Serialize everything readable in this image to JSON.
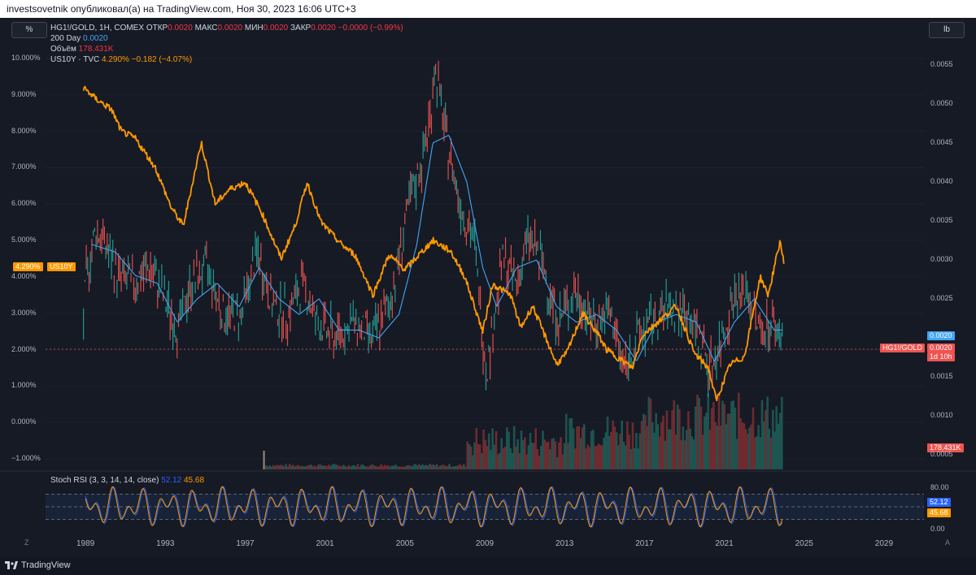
{
  "header": {
    "text": "investsovetnik опубликовал(а) на TradingView.com, Ноя 30, 2023 16:06 UTC+3"
  },
  "legend": {
    "symbol": "HG1!/GOLD, 1H, COMEX",
    "open_label": "ОТКР",
    "open": "0.0020",
    "high_label": "МАКС",
    "high": "0.0020",
    "low_label": "МИН",
    "low": "0.0020",
    "close_label": "ЗАКР",
    "close": "0.0020",
    "change": "−0.0000 (−0.99%)",
    "ma_label": "200 Day",
    "ma_value": "0.0020",
    "vol_label": "Объём",
    "vol_value": "178.431K",
    "us10y_label": "US10Y · TVC",
    "us10y_value": "4.290%",
    "us10y_change": "−0.182 (−4.07%)"
  },
  "controls": {
    "left_scale": "%",
    "right_scale": "lb",
    "bottom_left": "Z",
    "bottom_right": "A"
  },
  "rsi": {
    "label": "Stoch RSI (3, 3, 14, 14, close)",
    "k": "52.12",
    "d": "45.68",
    "levels": [
      "80.00",
      "0.00"
    ],
    "k_tag": "52.12",
    "d_tag": "45.68"
  },
  "tags": {
    "us10y_value": "4.290%",
    "us10y_name": "US10Y",
    "ma": "0.0020",
    "ratio_name": "HG1!/GOLD",
    "ratio_value": "0.0020",
    "countdown": "1d 10h",
    "volume": "178.431K"
  },
  "footer": {
    "brand": "TradingView"
  },
  "colors": {
    "us10y": "#ff9800",
    "ratio_up": "#26a69a",
    "ratio_down": "#ef5350",
    "ma": "#42a5f5",
    "rsi_k": "#2962ff",
    "rsi_d": "#ff9800"
  },
  "chart_data": {
    "type": "line",
    "x_ticks": [
      "1989",
      "1993",
      "1997",
      "2001",
      "2005",
      "2009",
      "2013",
      "2017",
      "2021",
      "2025",
      "2029"
    ],
    "left_axis": {
      "unit": "%",
      "ticks": [
        "10.000%",
        "9.000%",
        "8.000%",
        "7.000%",
        "6.000%",
        "5.000%",
        "4.000%",
        "3.000%",
        "2.000%",
        "1.000%",
        "0.000%",
        "−1.000%"
      ],
      "range": [
        -1,
        10
      ]
    },
    "right_axis": {
      "ticks": [
        "0.0055",
        "0.0050",
        "0.0045",
        "0.0040",
        "0.0035",
        "0.0030",
        "0.0025",
        "0.0015",
        "0.0010",
        "0.0005"
      ],
      "range": [
        0.0005,
        0.0055
      ]
    },
    "series": [
      {
        "name": "US10Y",
        "axis": "left",
        "x": [
          1988.9,
          1989.5,
          1990.3,
          1990.8,
          1991.5,
          1992.5,
          1993.3,
          1993.9,
          1994.8,
          1995.5,
          1996.2,
          1997.0,
          1997.8,
          1998.8,
          1999.5,
          2000.1,
          2000.8,
          2001.8,
          2002.5,
          2003.4,
          2004.2,
          2005.0,
          2006.4,
          2007.3,
          2008.0,
          2008.9,
          2009.4,
          2010.3,
          2010.8,
          2011.4,
          2012.6,
          2013.1,
          2013.9,
          2014.7,
          2015.1,
          2016.4,
          2016.9,
          2018.6,
          2019.5,
          2020.2,
          2020.6,
          2021.3,
          2022.0,
          2022.8,
          2023.2,
          2023.8,
          2024.0
        ],
        "y": [
          9.2,
          8.9,
          8.6,
          8.0,
          7.8,
          7.0,
          5.9,
          5.4,
          7.7,
          6.0,
          6.4,
          6.6,
          5.8,
          4.5,
          5.4,
          6.6,
          5.5,
          4.9,
          4.6,
          3.5,
          4.6,
          4.2,
          5.0,
          4.7,
          4.0,
          2.5,
          3.8,
          3.5,
          2.6,
          3.2,
          1.6,
          1.9,
          3.0,
          2.4,
          2.0,
          1.5,
          2.4,
          3.2,
          1.9,
          1.5,
          0.6,
          1.6,
          1.8,
          4.0,
          3.5,
          5.0,
          4.3
        ]
      },
      {
        "name": "HG1!/GOLD",
        "axis": "right",
        "x": [
          1988.9,
          1989.0,
          1989.5,
          1990.0,
          1990.6,
          1991.4,
          1992.2,
          1992.8,
          1993.6,
          1994.3,
          1995.1,
          1995.9,
          1996.8,
          1997.6,
          1998.4,
          1999.1,
          1999.9,
          2000.6,
          2001.5,
          2002.4,
          2003.4,
          2004.3,
          2005.2,
          2005.9,
          2006.3,
          2006.5,
          2007.1,
          2007.8,
          2008.5,
          2008.9,
          2009.1,
          2009.9,
          2010.6,
          2011.2,
          2011.8,
          2012.7,
          2013.5,
          2014.4,
          2015.3,
          2016.0,
          2016.6,
          2017.4,
          2018.3,
          2019.2,
          2019.9,
          2020.3,
          2020.9,
          2021.4,
          2022.1,
          2022.8,
          2023.4,
          2023.9
        ],
        "y": [
          0.0022,
          0.0027,
          0.0034,
          0.0032,
          0.0028,
          0.0027,
          0.0029,
          0.0026,
          0.0021,
          0.0027,
          0.0029,
          0.0023,
          0.0023,
          0.0031,
          0.0024,
          0.0023,
          0.0027,
          0.0022,
          0.002,
          0.0022,
          0.002,
          0.0025,
          0.0037,
          0.0043,
          0.0049,
          0.0055,
          0.0045,
          0.0037,
          0.0032,
          0.002,
          0.0016,
          0.003,
          0.0027,
          0.0033,
          0.003,
          0.0022,
          0.0026,
          0.0022,
          0.0023,
          0.0016,
          0.002,
          0.0022,
          0.0024,
          0.0023,
          0.0019,
          0.0016,
          0.002,
          0.0025,
          0.0026,
          0.0021,
          0.0022,
          0.002
        ]
      },
      {
        "name": "200 Day",
        "axis": "right",
        "x": [
          1989.3,
          1990.5,
          1991.5,
          1992.6,
          1993.6,
          1994.6,
          1995.6,
          1996.7,
          1997.7,
          1998.7,
          1999.7,
          2000.7,
          2001.7,
          2002.7,
          2003.7,
          2004.7,
          2005.6,
          2006.4,
          2007.2,
          2008.1,
          2008.9,
          2009.6,
          2010.6,
          2011.6,
          2012.6,
          2013.6,
          2014.6,
          2015.6,
          2016.6,
          2017.6,
          2018.6,
          2019.6,
          2020.5,
          2021.5,
          2022.5,
          2023.5,
          2023.9
        ],
        "y": [
          0.0032,
          0.0031,
          0.0028,
          0.0027,
          0.0022,
          0.0025,
          0.0027,
          0.0024,
          0.0029,
          0.0025,
          0.0023,
          0.0025,
          0.0021,
          0.0021,
          0.002,
          0.0023,
          0.0032,
          0.0045,
          0.0046,
          0.004,
          0.0029,
          0.0024,
          0.0029,
          0.003,
          0.0024,
          0.0022,
          0.0023,
          0.0021,
          0.0017,
          0.0022,
          0.0023,
          0.0022,
          0.0017,
          0.0022,
          0.0025,
          0.0021,
          0.0021
        ]
      }
    ],
    "volume": {
      "name": "Объём",
      "last": "178.431K"
    },
    "stoch_rsi": {
      "k": 52.12,
      "d": 45.68,
      "upper": 80,
      "lower": 20
    },
    "annotations": [
      "US10Y 4.290%",
      "HG1!/GOLD 0.0020",
      "200 Day 0.0020",
      "1d 10h",
      "178.431K"
    ]
  }
}
